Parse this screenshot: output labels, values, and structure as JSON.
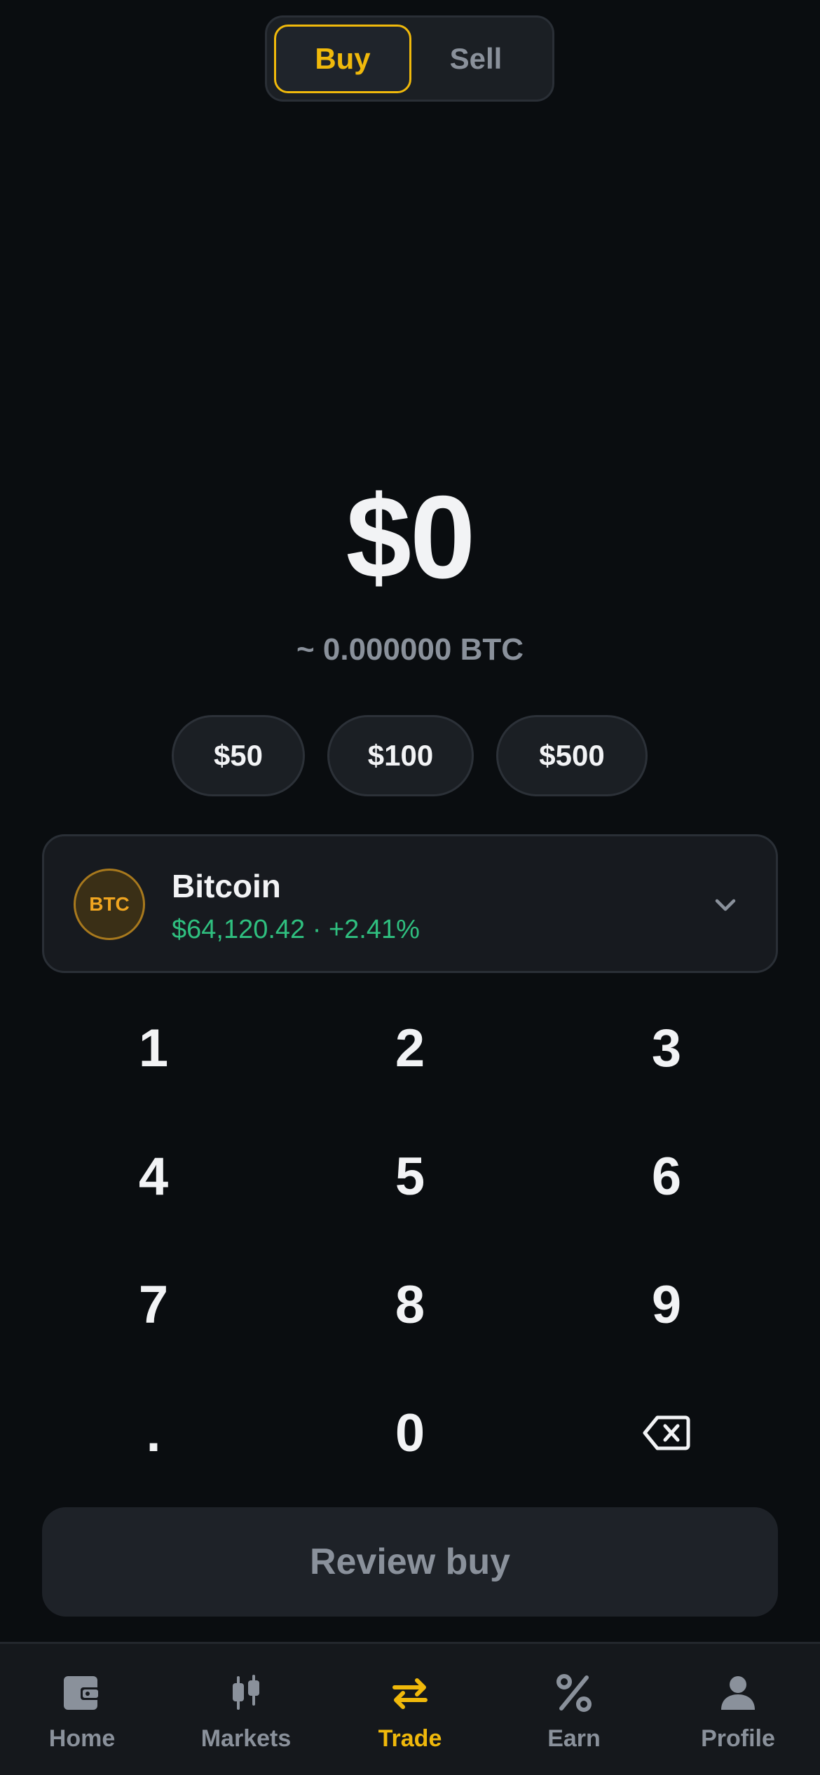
{
  "toggle": {
    "buy_label": "Buy",
    "sell_label": "Sell",
    "selected": "Buy"
  },
  "amount": {
    "value": "$0",
    "btc_estimate": "~ 0.000000 BTC"
  },
  "quick_amounts": [
    "$50",
    "$100",
    "$500"
  ],
  "asset": {
    "logo_text": "BTC",
    "name": "Bitcoin",
    "price_change": "$64,120.42 · +2.41%",
    "icon": "chevron-down-icon"
  },
  "keypad": {
    "k1": "1",
    "k2": "2",
    "k3": "3",
    "k4": "4",
    "k5": "5",
    "k6": "6",
    "k7": "7",
    "k8": "8",
    "k9": "9",
    "dot": ".",
    "k0": "0",
    "backspace_icon": "backspace-icon"
  },
  "review_button": {
    "label": "Review buy"
  },
  "nav": {
    "items": [
      {
        "label": "Home",
        "icon": "wallet-icon"
      },
      {
        "label": "Markets",
        "icon": "candlestick-icon"
      },
      {
        "label": "Trade",
        "icon": "swap-arrows-icon",
        "active": true
      },
      {
        "label": "Earn",
        "icon": "percent-icon"
      },
      {
        "label": "Profile",
        "icon": "person-icon"
      }
    ]
  },
  "colors": {
    "accent": "#f0b90b",
    "positive": "#2fbf7f",
    "background": "#0a0d10",
    "muted": "#8a919b"
  }
}
